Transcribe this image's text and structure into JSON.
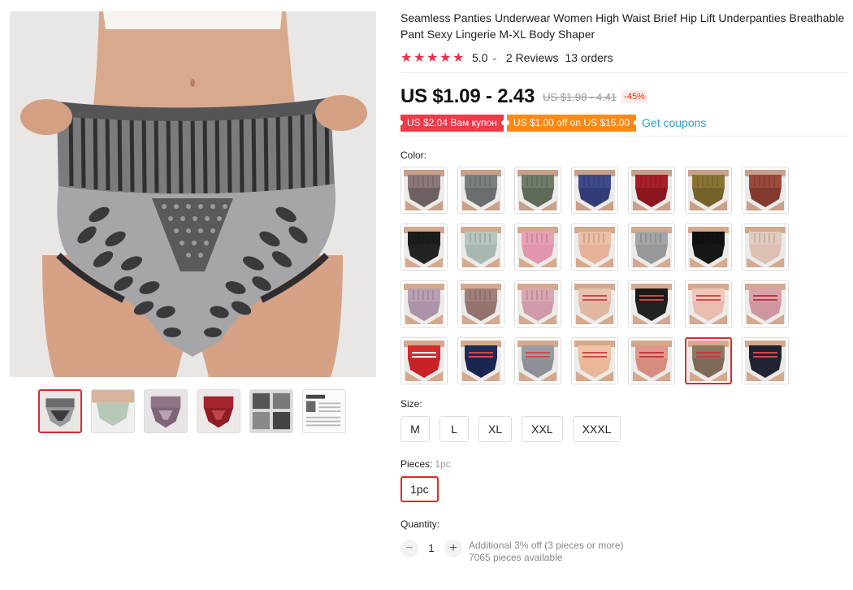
{
  "product": {
    "title": "Seamless Panties Underwear Women High Waist Brief Hip Lift Underpanties Breathable Pant Sexy Lingerie M-XL Body Shaper",
    "rating": "5.0",
    "reviews": "2 Reviews",
    "orders": "13 orders"
  },
  "price": {
    "current": "US $1.09 - 2.43",
    "original": "US $1.98 - 4.41",
    "discount": "-45%"
  },
  "coupons": {
    "coupon1": "US $2.04 Вам купон",
    "coupon2": "US $1.00 off on US $15.00",
    "get_link": "Get coupons"
  },
  "color": {
    "label": "Color:",
    "swatches": [
      {
        "top": "#8c7878",
        "body": "#6e6060",
        "skin": "#c9a08a"
      },
      {
        "top": "#7a7f82",
        "body": "#6a6e70",
        "skin": "#c9a08a"
      },
      {
        "top": "#6f7c68",
        "body": "#5e6a57",
        "skin": "#c9a08a"
      },
      {
        "top": "#3f4a8a",
        "body": "#323c78",
        "skin": "#c9a08a"
      },
      {
        "top": "#a81e2a",
        "body": "#8c1620",
        "skin": "#c9a08a"
      },
      {
        "top": "#8a7434",
        "body": "#75622a",
        "skin": "#c9a08a"
      },
      {
        "top": "#9a4a3c",
        "body": "#82392e",
        "skin": "#c9a08a"
      },
      {
        "top": "#1c1c1c",
        "body": "#222222",
        "skin": "#d4a98e"
      },
      {
        "top": "#b8c6bd",
        "body": "#a9b8ae",
        "skin": "#d4a98e"
      },
      {
        "top": "#e8a0b4",
        "body": "#e296ab",
        "skin": "#d4a98e"
      },
      {
        "top": "#ecbfa6",
        "body": "#e6b39a",
        "skin": "#d4a98e"
      },
      {
        "top": "#a3a5a6",
        "body": "#96989a",
        "skin": "#d4a98e"
      },
      {
        "top": "#111111",
        "body": "#161616",
        "skin": "#d4a98e"
      },
      {
        "top": "#e3cbbf",
        "body": "#dcc0b3",
        "skin": "#d4a98e"
      },
      {
        "top": "#b9a0b4",
        "body": "#ad93a8",
        "skin": "#d4a98e"
      },
      {
        "top": "#a0807a",
        "body": "#94736d",
        "skin": "#d4a98e"
      },
      {
        "top": "#d9a6b2",
        "body": "#d19aa8",
        "skin": "#d4a98e"
      },
      {
        "top": "#e8c3b0",
        "body": "#e2b7a2",
        "skin": "#d4a98e",
        "stripe": "#d04848"
      },
      {
        "top": "#1a1a1a",
        "body": "#222222",
        "skin": "#d4a98e",
        "stripe": "#d04848"
      },
      {
        "top": "#efc8bb",
        "body": "#e8bcae",
        "skin": "#d4a98e",
        "stripe": "#d04848"
      },
      {
        "top": "#d8a2aa",
        "body": "#cf96a0",
        "skin": "#d4a98e",
        "stripe": "#b83a48"
      },
      {
        "top": "#d42a2e",
        "body": "#c82227",
        "skin": "#d4a98e",
        "stripe": "#ffffff"
      },
      {
        "top": "#1d2b57",
        "body": "#1a2650",
        "skin": "#d4a98e",
        "stripe": "#d04848"
      },
      {
        "top": "#9a9ca3",
        "body": "#8e9097",
        "skin": "#d4a98e",
        "stripe": "#d04848"
      },
      {
        "top": "#efc3a6",
        "body": "#e9b89a",
        "skin": "#d4a98e",
        "stripe": "#d04848"
      },
      {
        "top": "#e0988a",
        "body": "#d88c7f",
        "skin": "#d4a98e",
        "stripe": "#c23a40"
      },
      {
        "top": "#8b7762",
        "body": "#7e6b57",
        "skin": "#d4a98e",
        "stripe": "#c23a40"
      },
      {
        "top": "#1e2230",
        "body": "#202432",
        "skin": "#d4a98e",
        "stripe": "#d04848"
      }
    ],
    "selected_index": 26
  },
  "size": {
    "label": "Size:",
    "options": [
      "M",
      "L",
      "XL",
      "XXL",
      "XXXL"
    ]
  },
  "pieces": {
    "label": "Pieces:",
    "selected_label": "1pc",
    "option": "1pc"
  },
  "quantity": {
    "label": "Quantity:",
    "minus": "−",
    "value": "1",
    "plus": "+",
    "note": "Additional 3% off (3 pieces or more)",
    "available": "7065 pieces available"
  },
  "thumbnails": [
    {
      "name": "gray",
      "top": "#777777",
      "body": "#5f5f5f"
    },
    {
      "name": "mint",
      "top": "#b6c8b8",
      "body": "#a7bba9"
    },
    {
      "name": "mauve",
      "top": "#8f7486",
      "body": "#7e6476"
    },
    {
      "name": "red",
      "top": "#a4232c",
      "body": "#8f1b23"
    },
    {
      "name": "collage",
      "top": "#555555",
      "body": "#888888"
    },
    {
      "name": "size-chart",
      "top": "#f5f5f5",
      "body": "#dddddd"
    }
  ],
  "colors": {
    "accent_red": "#e0282e",
    "star": "#e6314a",
    "link": "#2e9cc3",
    "coupon_red": "#ef3a48",
    "coupon_orange": "#fd8a15"
  }
}
